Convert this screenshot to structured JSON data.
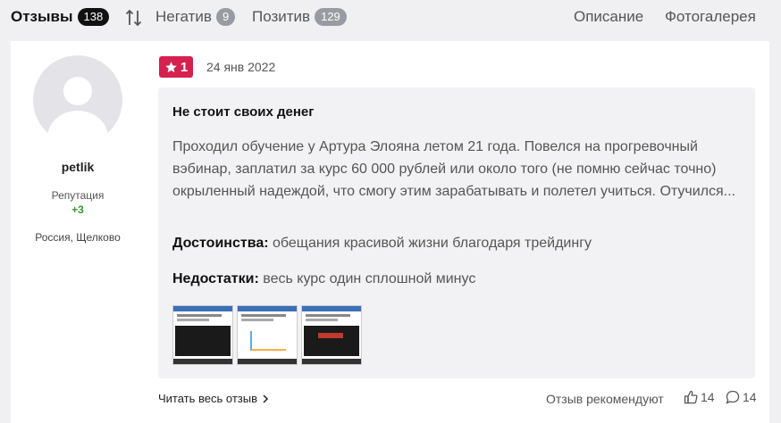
{
  "tabs": {
    "reviews": {
      "label": "Отзывы",
      "count": "138"
    },
    "negative": {
      "label": "Негатив",
      "count": "9"
    },
    "positive": {
      "label": "Позитив",
      "count": "129"
    },
    "description": "Описание",
    "gallery": "Фотогалерея",
    "sort_icon": "sort-arrows-icon"
  },
  "author": {
    "name": "petlik",
    "reputation_label": "Репутация",
    "reputation_value": "+3",
    "location": "Россия, Щелково",
    "avatar_icon": "user-placeholder-icon"
  },
  "review": {
    "rating": "1",
    "rating_icon": "star-icon",
    "rating_color": "#d6204f",
    "date": "24 янв 2022",
    "title": "Не стоит своих денег",
    "text": "Проходил обучение у Артура Элояна летом 21 года. Повелся на прогревочный вэбинар, заплатил за курс 60 000 рублей или около того (не помню сейчас точно) окрыленный надеждой, что смогу этим зарабатывать и полетел учиться. Отучился...",
    "pros_label": "Достоинства:",
    "pros": "обещания красивой жизни благодаря трейдингу",
    "cons_label": "Недостатки:",
    "cons": "весь курс один сплошной минус"
  },
  "footer": {
    "read_more": "Читать весь отзыв",
    "recommend": "Отзыв рекомендуют",
    "likes": "14",
    "comments": "14"
  }
}
